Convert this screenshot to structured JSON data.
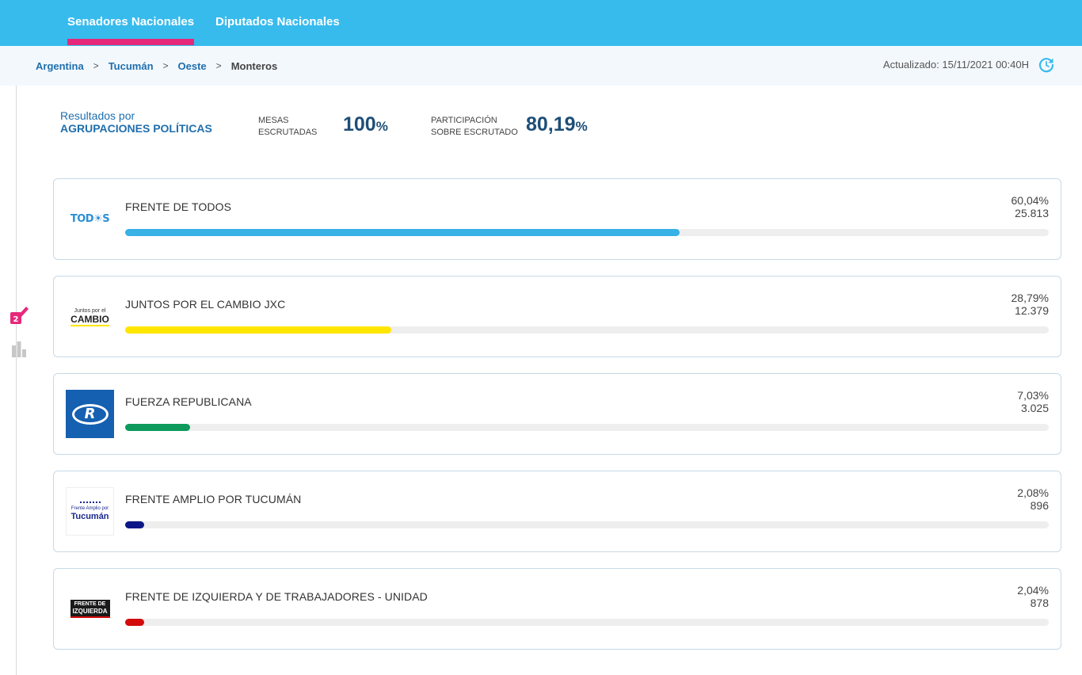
{
  "nav": {
    "tabs": [
      {
        "label": "Senadores Nacionales",
        "active": true
      },
      {
        "label": "Diputados Nacionales",
        "active": false
      }
    ],
    "accent_color": "#37bbed",
    "active_underline_color": "#e6287b"
  },
  "breadcrumb": {
    "items": [
      "Argentina",
      "Tucumán",
      "Oeste",
      "Monteros"
    ],
    "separator": ">"
  },
  "status": {
    "updated": "Actualizado: 15/11/2021 00:40H",
    "refresh_icon": "refresh-icon"
  },
  "sidebar": {
    "icons": [
      "ballot-box-icon",
      "bar-chart-icon"
    ]
  },
  "summary": {
    "label_line1": "Resultados por",
    "label_line2": "AGRUPACIONES POLÍTICAS",
    "mesas_label_1": "MESAS",
    "mesas_label_2": "ESCRUTADAS",
    "mesas_value": "100",
    "mesas_unit": "%",
    "participacion_label_1": "PARTICIPACIÓN",
    "participacion_label_2": "SOBRE ESCRUTADO",
    "participacion_value": "80,19",
    "participacion_unit": "%"
  },
  "parties": [
    {
      "name": "FRENTE DE TODOS",
      "pct_text": "60,04%",
      "votes": "25.813",
      "pct": 60.04,
      "color": "#37b1e6",
      "logo_text": "TOD☀S"
    },
    {
      "name": "JUNTOS POR EL CAMBIO JXC",
      "pct_text": "28,79%",
      "votes": "12.379",
      "pct": 28.79,
      "color": "#ffe600",
      "logo_text_1": "Juntos por el",
      "logo_text_2": "CAMBIO"
    },
    {
      "name": "FUERZA REPUBLICANA",
      "pct_text": "7,03%",
      "votes": "3.025",
      "pct": 7.03,
      "color": "#0d9a5c",
      "logo_text": "R"
    },
    {
      "name": "FRENTE AMPLIO POR TUCUMÁN",
      "pct_text": "2,08%",
      "votes": "896",
      "pct": 2.08,
      "color": "#0c1787",
      "logo_text_1": "Frente Amplio por",
      "logo_text_2": "Tucumán"
    },
    {
      "name": "FRENTE DE IZQUIERDA Y DE TRABAJADORES - UNIDAD",
      "pct_text": "2,04%",
      "votes": "878",
      "pct": 2.04,
      "color": "#d40b0b",
      "logo_text_1": "FRENTE DE",
      "logo_text_2": "IZQUIERDA"
    }
  ]
}
